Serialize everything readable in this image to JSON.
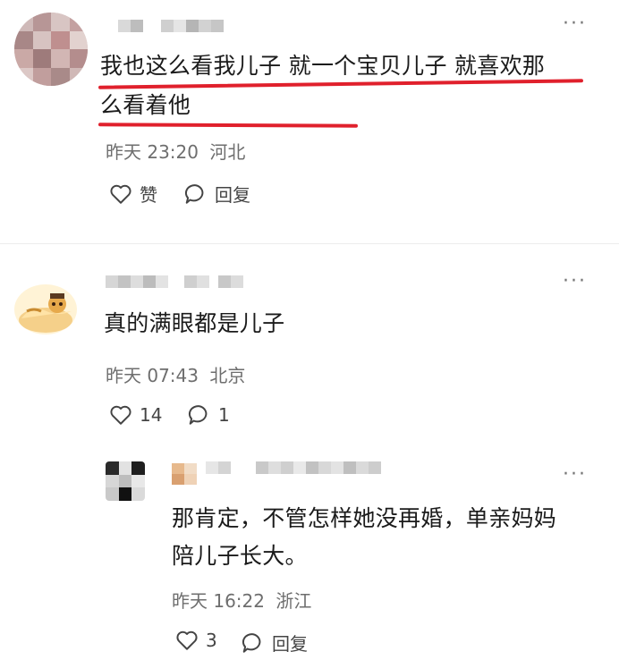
{
  "comments": [
    {
      "text_line1": "我也这么看我儿子 就一个宝贝儿子 就喜欢那",
      "text_line2": "么看着他",
      "time": "昨天 23:20",
      "location": "河北",
      "like_label": "赞",
      "reply_label": "回复"
    },
    {
      "text_line1": "真的满眼都是儿子",
      "time": "昨天 07:43",
      "location": "北京",
      "like_count": "14",
      "reply_count": "1"
    },
    {
      "text_line1": "那肯定，不管怎样她没再婚，单亲妈妈",
      "text_line2": "陪儿子长大。",
      "time": "昨天 16:22",
      "location": "浙江",
      "like_count": "3",
      "reply_label": "回复"
    }
  ],
  "more_label": "···",
  "colors": {
    "highlight": "#e0202c",
    "meta_text": "#6e6e6e"
  }
}
